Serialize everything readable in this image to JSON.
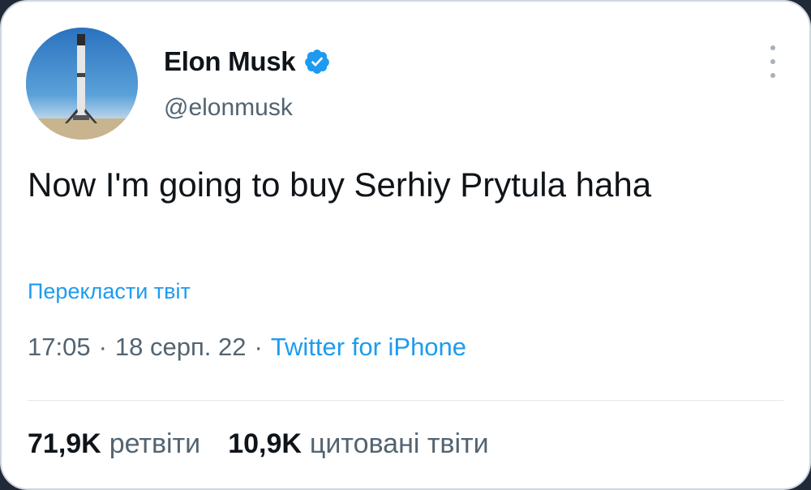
{
  "author": {
    "display_name": "Elon Musk",
    "handle": "@elonmusk",
    "verified": true
  },
  "tweet": {
    "text": "Now I'm going to buy Serhiy Prytula haha",
    "translate_link": "Перекласти твіт",
    "time": "17:05",
    "date": "18 серп. 22",
    "separator": "·",
    "source": "Twitter for iPhone"
  },
  "stats": [
    {
      "value": "71,9K",
      "label": "ретвіти"
    },
    {
      "value": "10,9K",
      "label": "цитовані твіти"
    }
  ],
  "colors": {
    "accent": "#1d9bf0",
    "text": "#0f1419",
    "secondary": "#536471"
  },
  "icons": {
    "verified": "verified-badge-icon",
    "more": "more-options-icon"
  }
}
